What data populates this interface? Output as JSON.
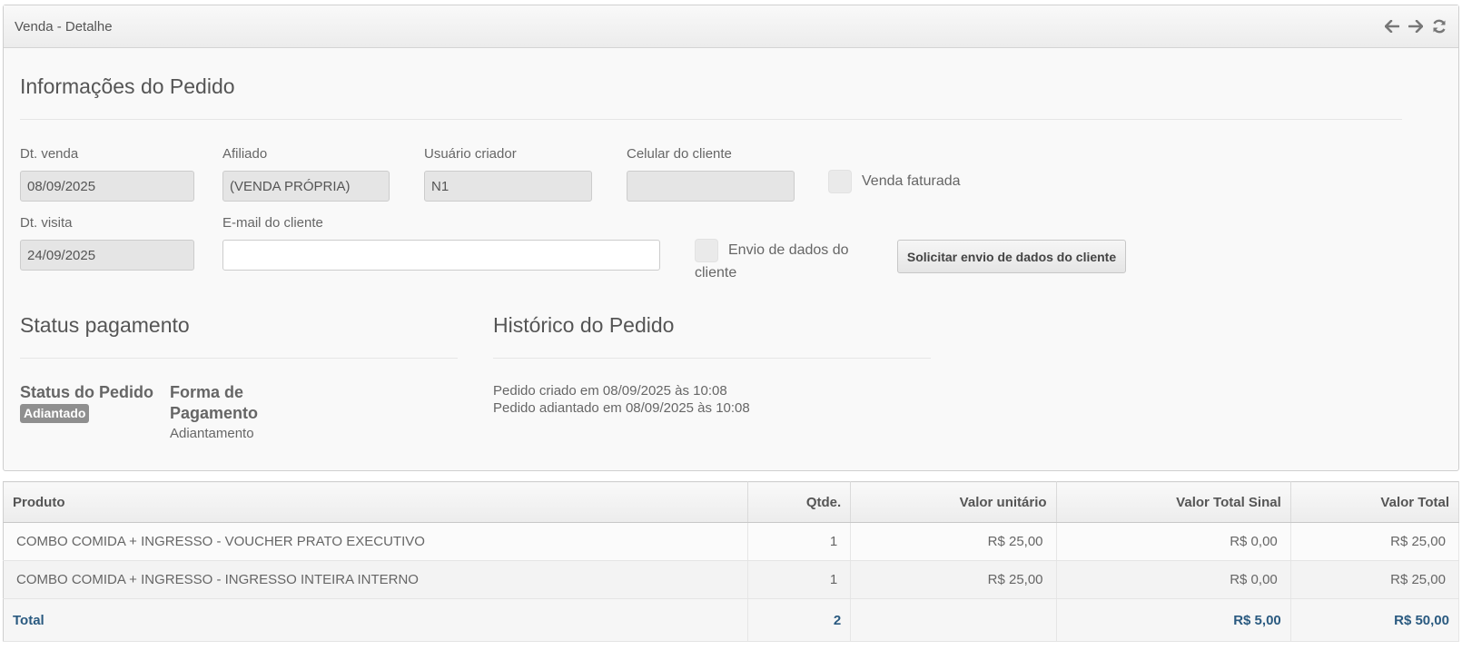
{
  "panel": {
    "title": "Venda - Detalhe",
    "icons": [
      "arrow-left-icon",
      "arrow-right-icon",
      "refresh-icon"
    ]
  },
  "order_info": {
    "title": "Informações do Pedido",
    "dt_venda": {
      "label": "Dt. venda",
      "value": "08/09/2025"
    },
    "afiliado": {
      "label": "Afiliado",
      "value": "(VENDA PRÓPRIA)"
    },
    "usuario_criador": {
      "label": "Usuário criador",
      "value": "N1"
    },
    "celular_cliente": {
      "label": "Celular do cliente",
      "value": ""
    },
    "venda_faturada": {
      "label": "Venda faturada",
      "checked": false
    },
    "dt_visita": {
      "label": "Dt. visita",
      "value": "24/09/2025"
    },
    "email_cliente": {
      "label": "E-mail do cliente",
      "value": ""
    },
    "envio_dados": {
      "label_line1": "Envio de dados do",
      "label_line2": "cliente",
      "checked": false
    },
    "solicitar_button": "Solicitar envio de dados do cliente"
  },
  "status_pagamento": {
    "title": "Status pagamento",
    "status_pedido_label": "Status do Pedido",
    "status_badge": "Adiantado",
    "forma_pagamento_label_line1": "Forma de",
    "forma_pagamento_label_line2": "Pagamento",
    "forma_pagamento_value": "Adiantamento"
  },
  "historico": {
    "title": "Histórico do Pedido",
    "entries": [
      "Pedido criado em 08/09/2025 às 10:08",
      "Pedido adiantado em 08/09/2025 às 10:08"
    ]
  },
  "table": {
    "headers": [
      "Produto",
      "Qtde.",
      "Valor unitário",
      "Valor Total Sinal",
      "Valor Total"
    ],
    "rows": [
      [
        "COMBO COMIDA + INGRESSO - VOUCHER PRATO EXECUTIVO",
        "1",
        "R$ 25,00",
        "R$ 0,00",
        "R$ 25,00"
      ],
      [
        "COMBO COMIDA + INGRESSO - INGRESSO INTEIRA INTERNO",
        "1",
        "R$ 25,00",
        "R$ 0,00",
        "R$ 25,00"
      ]
    ],
    "total": [
      "Total",
      "2",
      "",
      "R$ 5,00",
      "R$ 50,00"
    ]
  }
}
